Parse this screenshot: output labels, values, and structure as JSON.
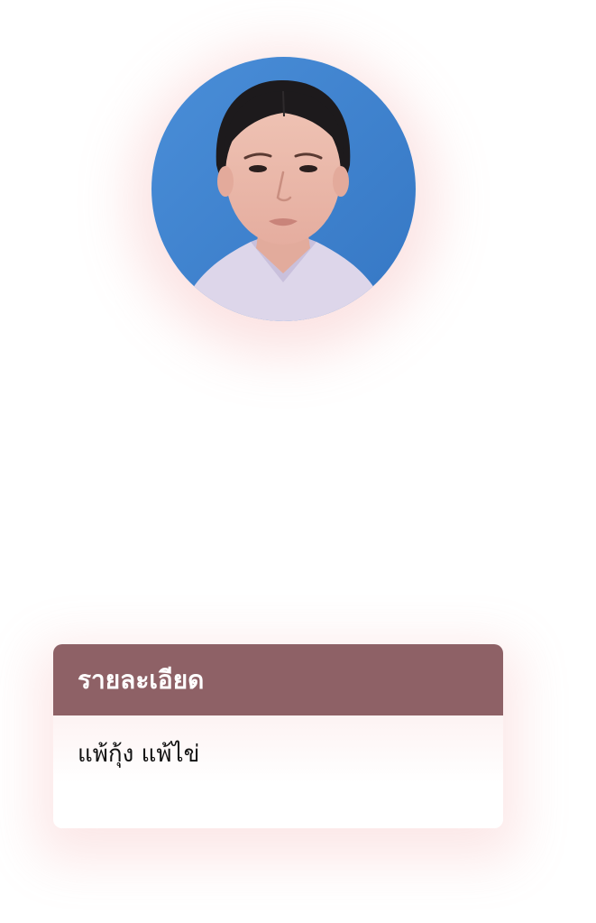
{
  "profile": {
    "avatar_alt": "profile photo"
  },
  "details_card": {
    "title": "รายละเอียด",
    "body": "แพ้กุ้ง แพ้ไข่"
  },
  "colors": {
    "header_bg": "#8e6166",
    "header_text": "#ffffff",
    "photo_background": "#3f82cf",
    "shadow_tint": "#f0a0a0"
  }
}
